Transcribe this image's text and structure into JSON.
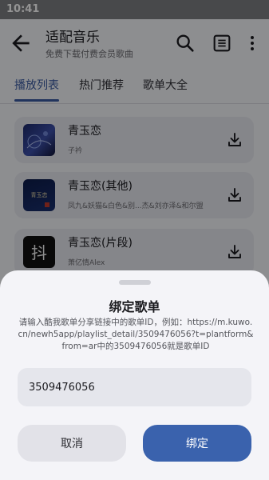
{
  "status_bar": {
    "time": "10:41"
  },
  "app_bar": {
    "title": "适配音乐",
    "subtitle": "免费下载付费会员歌曲",
    "icons": [
      "back-arrow-icon",
      "search-icon",
      "list-icon",
      "more-vert-icon"
    ]
  },
  "tabs": [
    {
      "label": "播放列表",
      "active": true
    },
    {
      "label": "热门推荐",
      "active": false
    },
    {
      "label": "歌单大全",
      "active": false
    }
  ],
  "songs": [
    {
      "title": "青玉恋",
      "artist": "子衿",
      "cover_text": ""
    },
    {
      "title": "青玉恋(其他)",
      "artist": "凤九&妖猫&白色&别...杰&刘亦泽&和尔盟",
      "cover_text": "青玉恋"
    },
    {
      "title": "青玉恋(片段)",
      "artist": "萧亿情Alex",
      "cover_text": "抖"
    }
  ],
  "dialog": {
    "title": "绑定歌单",
    "description": "请输入酷我歌单分享链接中的歌单ID，例如：https://m.kuwo.cn/newh5app/playlist_detail/3509476056?t=plantform&from=ar中的3509476056就是歌单ID",
    "input_value": "3509476056",
    "cancel_label": "取消",
    "confirm_label": "绑定"
  },
  "colors": {
    "accent": "#3a62ad",
    "scrim": "rgba(0,0,0,0.42)"
  }
}
